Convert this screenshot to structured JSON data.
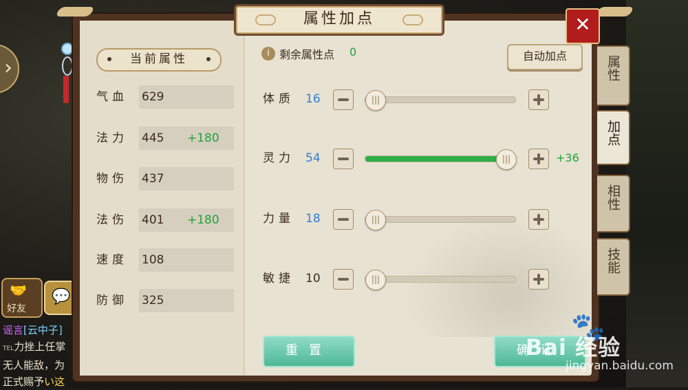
{
  "window": {
    "title": "属性加点",
    "close_label": "✕"
  },
  "current": {
    "title": "当前属性",
    "stats": [
      {
        "label": "气血",
        "value": "629",
        "bonus": ""
      },
      {
        "label": "法力",
        "value": "445",
        "bonus": "+180"
      },
      {
        "label": "物伤",
        "value": "437",
        "bonus": ""
      },
      {
        "label": "法伤",
        "value": "401",
        "bonus": "+180"
      },
      {
        "label": "速度",
        "value": "108",
        "bonus": ""
      },
      {
        "label": "防御",
        "value": "325",
        "bonus": ""
      }
    ]
  },
  "points": {
    "label": "剩余属性点",
    "value": "0",
    "auto_label": "自动加点"
  },
  "attributes": [
    {
      "label": "体质",
      "value": "16",
      "extra": "",
      "level": 0.0,
      "value_color": "#2f7fd6"
    },
    {
      "label": "灵力",
      "value": "54",
      "extra": "+36",
      "level": 1.0,
      "value_color": "#2f7fd6"
    },
    {
      "label": "力量",
      "value": "18",
      "extra": "",
      "level": 0.0,
      "value_color": "#2f7fd6"
    },
    {
      "label": "敏捷",
      "value": "10",
      "extra": "",
      "level": 0.0,
      "value_color": "#3a2b1e"
    }
  ],
  "buttons": {
    "reset": "重置",
    "confirm": "确认"
  },
  "tabs": [
    {
      "label": "属性",
      "active": false
    },
    {
      "label": "加点",
      "active": true
    },
    {
      "label": "相性",
      "active": false
    },
    {
      "label": "技能",
      "active": false
    }
  ],
  "chat": {
    "friend_label": "好友",
    "lines": [
      {
        "tag": "谣言",
        "name": "[云中子]",
        "text": ""
      },
      {
        "tag": "",
        "name": "",
        "text": "力挫上任掌"
      },
      {
        "tag": "",
        "name": "",
        "text": "无人能敌，为"
      },
      {
        "tag": "",
        "name": "",
        "text": "正式赐予",
        "highlight": "い这"
      }
    ]
  },
  "watermark": {
    "brand": "Bai  经验",
    "paw": "🐾",
    "url": "jingyan.baidu.com"
  },
  "colors": {
    "accent_green": "#20a23a",
    "value_blue": "#2f7fd6",
    "frame": "#4e3320",
    "button_teal": "#4fb896"
  }
}
